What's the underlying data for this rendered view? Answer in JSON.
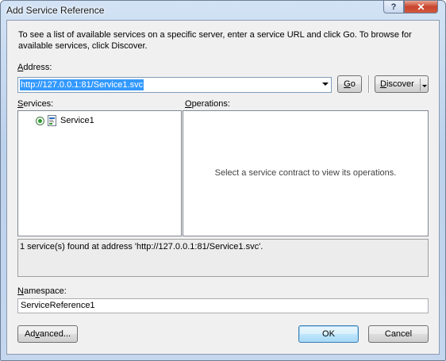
{
  "window": {
    "title": "Add Service Reference"
  },
  "titlebar": {
    "help_glyph": "?",
    "close_glyph": "✕"
  },
  "intro_text": "To see a list of available services on a specific server, enter a service URL and click Go. To browse for available services, click Discover.",
  "address": {
    "label_first": "A",
    "label_rest": "ddress:",
    "value": "http://127.0.0.1:81/Service1.svc"
  },
  "buttons": {
    "go_first": "G",
    "go_rest": "o",
    "discover_first": "D",
    "discover_rest": "iscover",
    "advanced_first": "Ad",
    "advanced_underlined": "v",
    "advanced_rest": "anced...",
    "ok": "OK",
    "cancel": "Cancel"
  },
  "services": {
    "label_first": "S",
    "label_rest": "ervices:",
    "items": [
      {
        "label": "Service1",
        "selected": true
      }
    ]
  },
  "operations": {
    "label_first": "O",
    "label_rest": "perations:",
    "empty_message": "Select a service contract to view its operations."
  },
  "status_text": "1 service(s) found at address 'http://127.0.0.1:81/Service1.svc'.",
  "namespace": {
    "label_first": "N",
    "label_rest": "amespace:",
    "value": "ServiceReference1"
  },
  "colors": {
    "selection": "#3399ff",
    "radio_dot": "#2c9a2c",
    "close_button": "#c8452d"
  },
  "icons": {
    "service": "wcf-service-icon",
    "radio": "radio-selected-icon",
    "combo": "chevron-down-icon"
  }
}
